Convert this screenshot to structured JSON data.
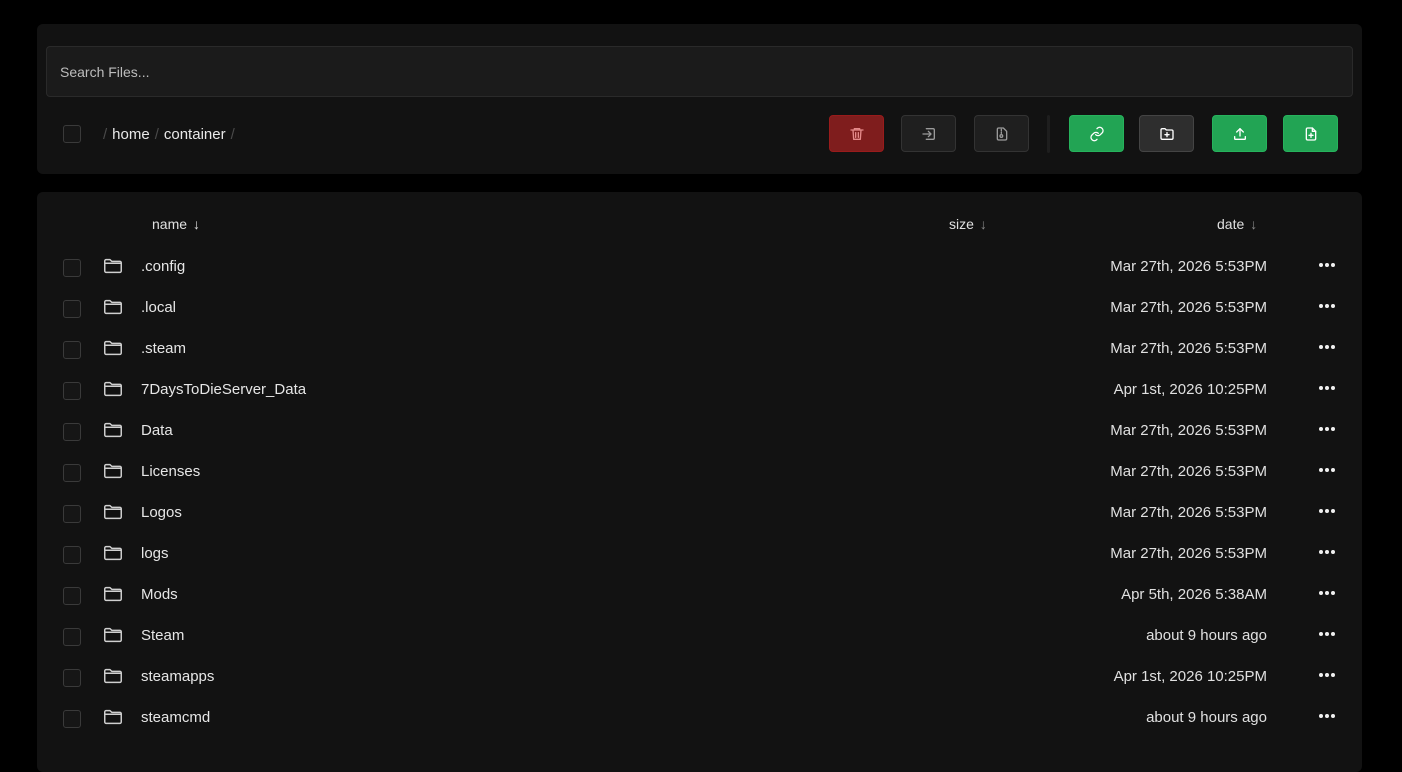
{
  "search": {
    "placeholder": "Search Files..."
  },
  "breadcrumb": {
    "items": [
      "home",
      "container"
    ],
    "separator": "/"
  },
  "toolbar": {
    "buttons": [
      {
        "name": "delete-button",
        "icon": "trash-icon"
      },
      {
        "name": "move-button",
        "icon": "move-file-icon"
      },
      {
        "name": "archive-button",
        "icon": "archive-file-icon"
      },
      {
        "name": "pull-url-button",
        "icon": "link-icon"
      },
      {
        "name": "new-folder-button",
        "icon": "folder-plus-icon"
      },
      {
        "name": "upload-button",
        "icon": "upload-icon"
      },
      {
        "name": "new-file-button",
        "icon": "file-plus-icon"
      }
    ]
  },
  "columns": {
    "name": "name",
    "size": "size",
    "date": "date",
    "arrow": "↓"
  },
  "files": [
    {
      "name": ".config",
      "size": "",
      "date": "Mar 27th, 2026 5:53PM"
    },
    {
      "name": ".local",
      "size": "",
      "date": "Mar 27th, 2026 5:53PM"
    },
    {
      "name": ".steam",
      "size": "",
      "date": "Mar 27th, 2026 5:53PM"
    },
    {
      "name": "7DaysToDieServer_Data",
      "size": "",
      "date": "Apr 1st, 2026 10:25PM"
    },
    {
      "name": "Data",
      "size": "",
      "date": "Mar 27th, 2026 5:53PM"
    },
    {
      "name": "Licenses",
      "size": "",
      "date": "Mar 27th, 2026 5:53PM"
    },
    {
      "name": "Logos",
      "size": "",
      "date": "Mar 27th, 2026 5:53PM"
    },
    {
      "name": "logs",
      "size": "",
      "date": "Mar 27th, 2026 5:53PM"
    },
    {
      "name": "Mods",
      "size": "",
      "date": "Apr 5th, 2026 5:38AM"
    },
    {
      "name": "Steam",
      "size": "",
      "date": "about 9 hours ago"
    },
    {
      "name": "steamapps",
      "size": "",
      "date": "Apr 1st, 2026 10:25PM"
    },
    {
      "name": "steamcmd",
      "size": "",
      "date": "about 9 hours ago"
    }
  ],
  "colors": {
    "danger": "#7f1d1d",
    "success": "#22a454",
    "panel": "#121212"
  }
}
